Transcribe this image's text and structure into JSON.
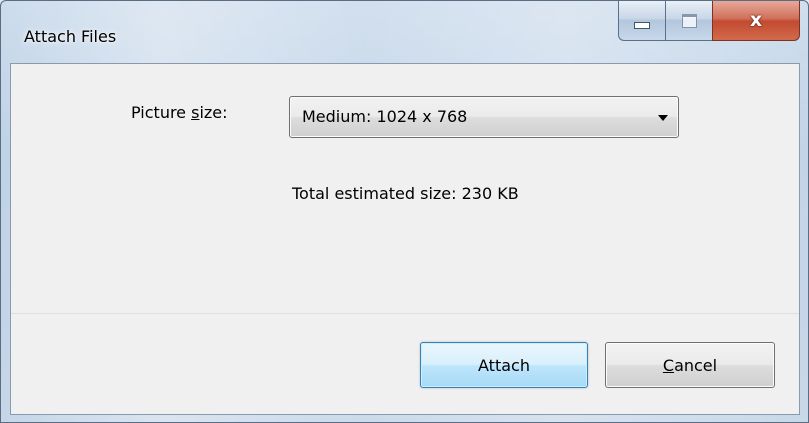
{
  "window": {
    "title": "Attach Files",
    "close_glyph": "x",
    "icons": {
      "minimize": "minimize-icon",
      "maximize": "maximize-icon",
      "close": "close-icon"
    }
  },
  "form": {
    "picture_size_label_pre": "Picture ",
    "picture_size_label_accel": "s",
    "picture_size_label_post": "ize:",
    "picture_size_value": "Medium: 1024 x 768",
    "total_size_text": "Total estimated size:  230 KB"
  },
  "buttons": {
    "attach_label": "Attach",
    "cancel_accel": "C",
    "cancel_rest": "ancel"
  },
  "colors": {
    "close_button": "#c24a30",
    "default_button_border": "#3c7fb1"
  }
}
